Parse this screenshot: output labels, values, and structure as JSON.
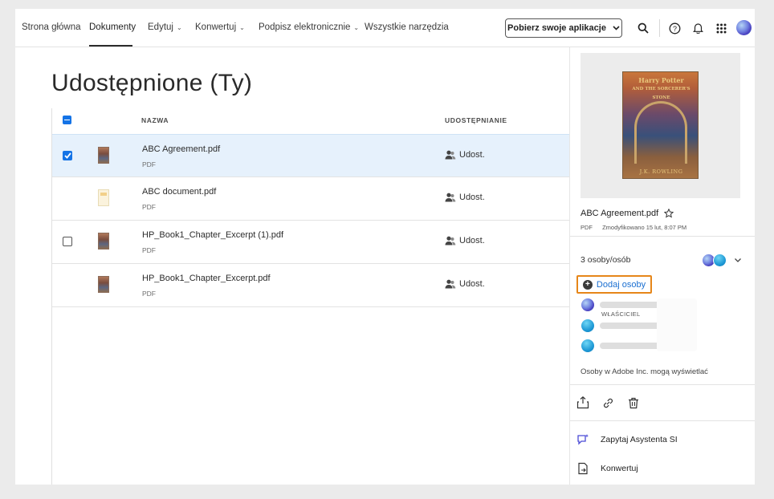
{
  "nav": {
    "items": [
      "Strona główna",
      "Dokumenty",
      "Edytuj",
      "Konwertuj",
      "Podpisz elektronicznie",
      "Wszystkie narzędzia"
    ],
    "get_apps_label": "Pobierz swoje aplikacje",
    "icons": [
      "search-icon",
      "help-icon",
      "bell-icon",
      "apps-grid-icon",
      "avatar"
    ]
  },
  "page": {
    "title": "Udostępnione (Ty)"
  },
  "list": {
    "headers": {
      "name": "NAZWA",
      "sharing": "UDOSTĘPNIANIE"
    },
    "rows": [
      {
        "name": "ABC Agreement.pdf",
        "type": "PDF",
        "sharing": "Udost.",
        "checked": true,
        "selected": true,
        "thumb": "book"
      },
      {
        "name": "ABC document.pdf",
        "type": "PDF",
        "sharing": "Udost.",
        "checked": false,
        "selected": false,
        "thumb": "doc"
      },
      {
        "name": "HP_Book1_Chapter_Excerpt (1).pdf",
        "type": "PDF",
        "sharing": "Udost.",
        "checked": false,
        "selected": false,
        "thumb": "book"
      },
      {
        "name": "HP_Book1_Chapter_Excerpt.pdf",
        "type": "PDF",
        "sharing": "Udost.",
        "checked": false,
        "selected": false,
        "thumb": "book"
      }
    ]
  },
  "panel": {
    "cover_title_line1": "Harry Potter",
    "cover_title_line2": "AND THE SORCERER'S STONE",
    "cover_author": "J.K. ROWLING",
    "file_name": "ABC Agreement.pdf",
    "file_type": "PDF",
    "modified": "Zmodyfikowano 15 lut, 8:07 PM",
    "people_count": "3 osoby/osób",
    "add_people_label": "Dodaj osoby",
    "owner_role": "WŁAŚCICIEL",
    "note": "Osoby w Adobe Inc. mogą wyświetlać",
    "menu": {
      "ask_ai": "Zapytaj Asystenta SI",
      "convert": "Konwertuj"
    }
  },
  "colors": {
    "accent": "#1473e6",
    "highlight_border": "#e68619",
    "selected_row": "#e6f1fc"
  }
}
